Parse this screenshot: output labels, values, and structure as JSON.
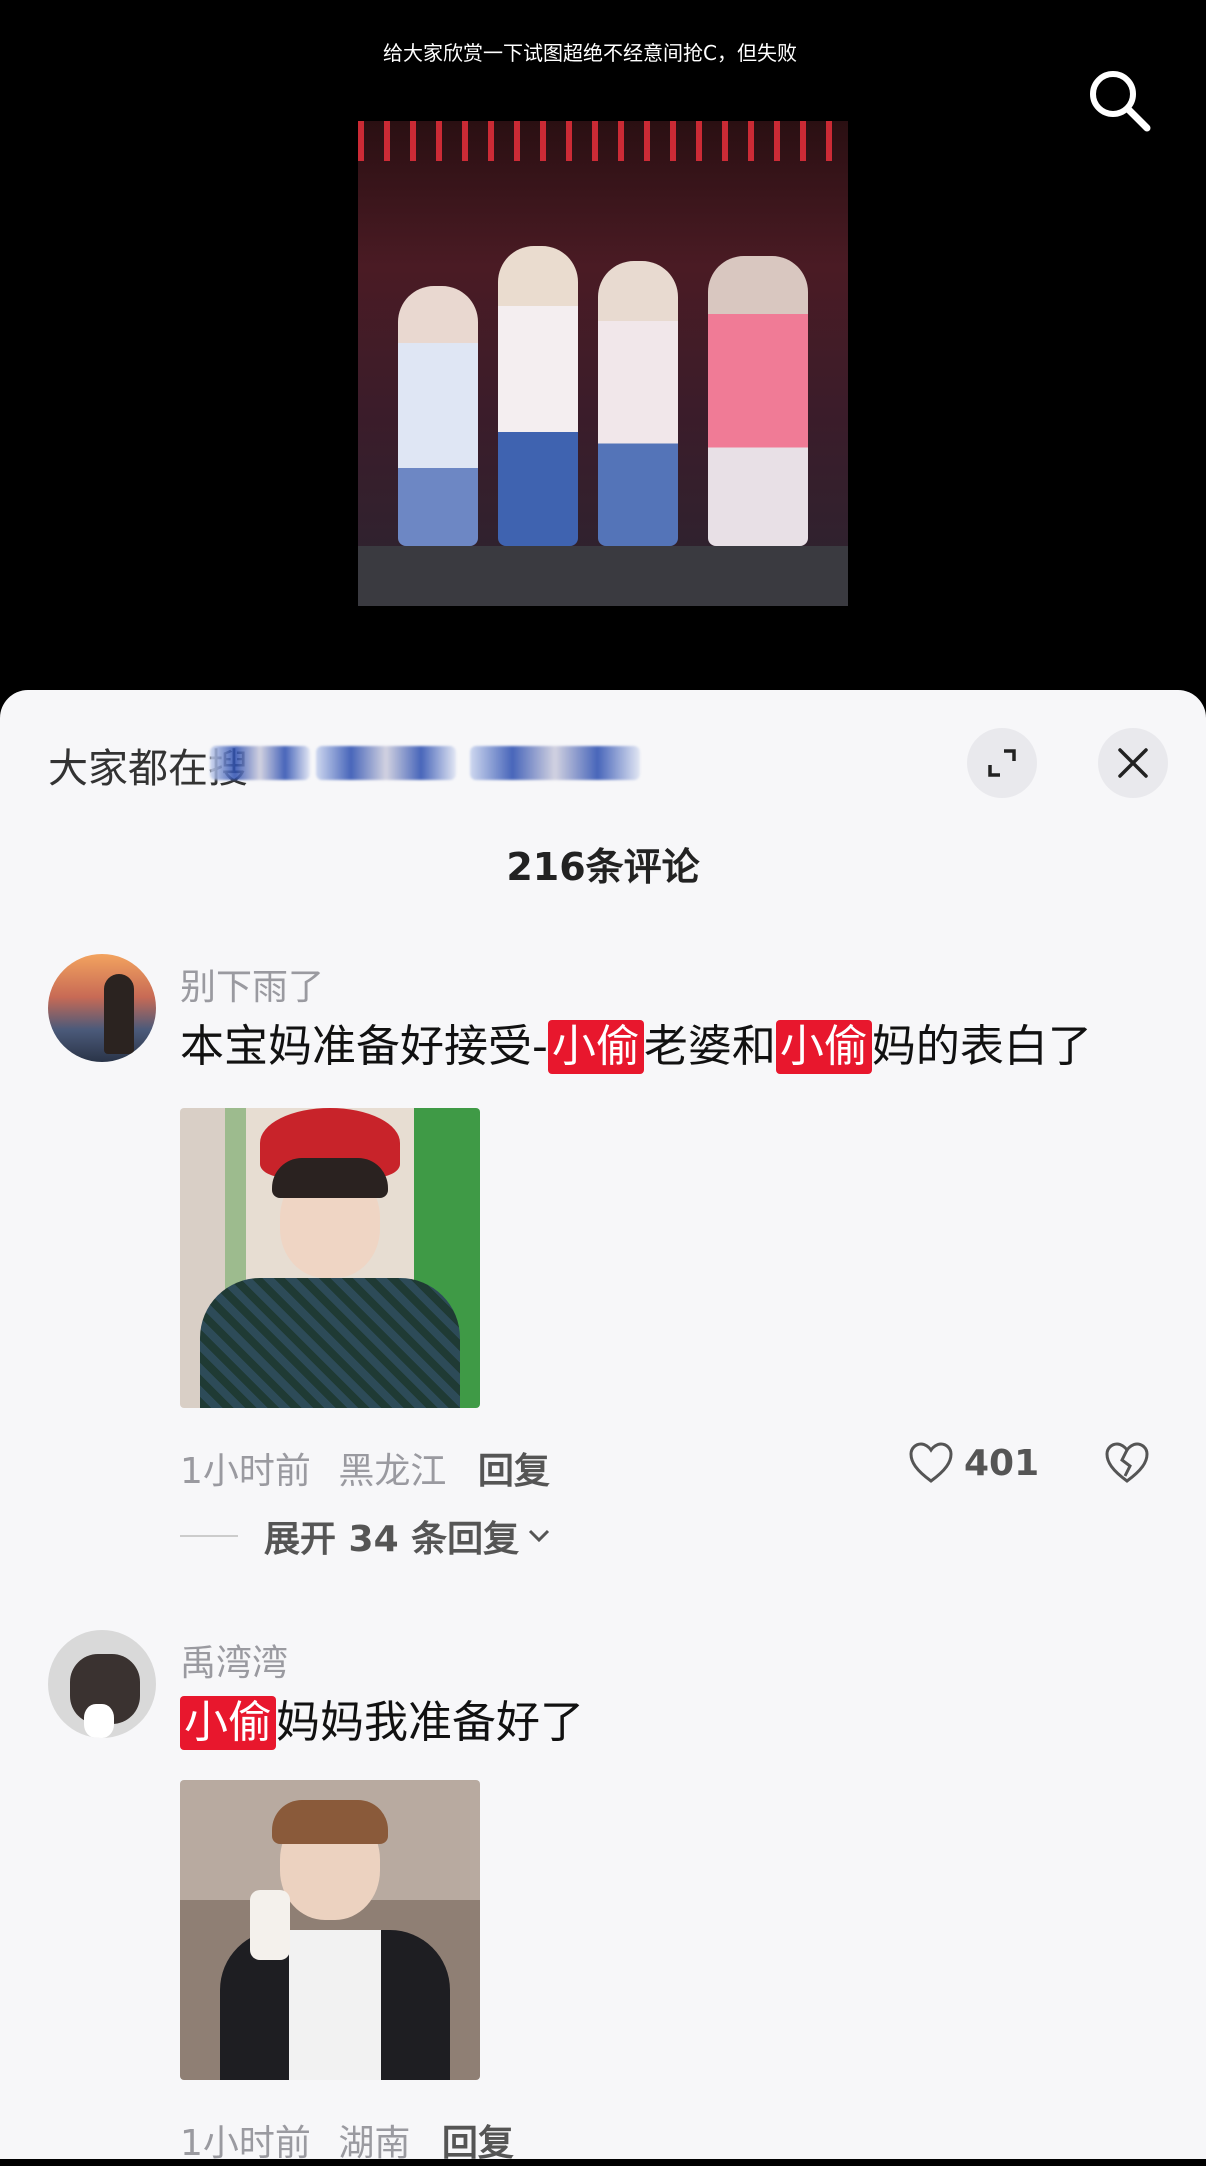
{
  "video": {
    "caption": "给大家欣赏一下试图超绝不经意间抢C，但失败"
  },
  "sheet": {
    "title": "大家都在搜",
    "comment_count": "216条评论"
  },
  "comments": [
    {
      "author": "别下雨了",
      "text_parts": [
        "本宝妈准备好接受-",
        "小偷",
        "老婆和",
        "小偷",
        "妈的表白了"
      ],
      "time": "1小时前",
      "location": "黑龙江",
      "reply_label": "回复",
      "likes": "401",
      "expand_label": "展开 34 条回复"
    },
    {
      "author": "禹湾湾",
      "text_parts": [
        "",
        "小偷",
        "妈妈我准备好了"
      ],
      "time": "1小时前",
      "location": "湖南",
      "reply_label": "回复"
    }
  ],
  "icons": {
    "search": "search-icon",
    "expand": "expand-icon",
    "close": "close-icon",
    "heart": "heart-icon",
    "broken_heart": "broken-heart-icon",
    "chevron": "chevron-down-icon"
  },
  "colors": {
    "tag_red": "#e8172d",
    "sheet_bg": "#f7f7f9",
    "muted_text": "#9a9aa0"
  }
}
